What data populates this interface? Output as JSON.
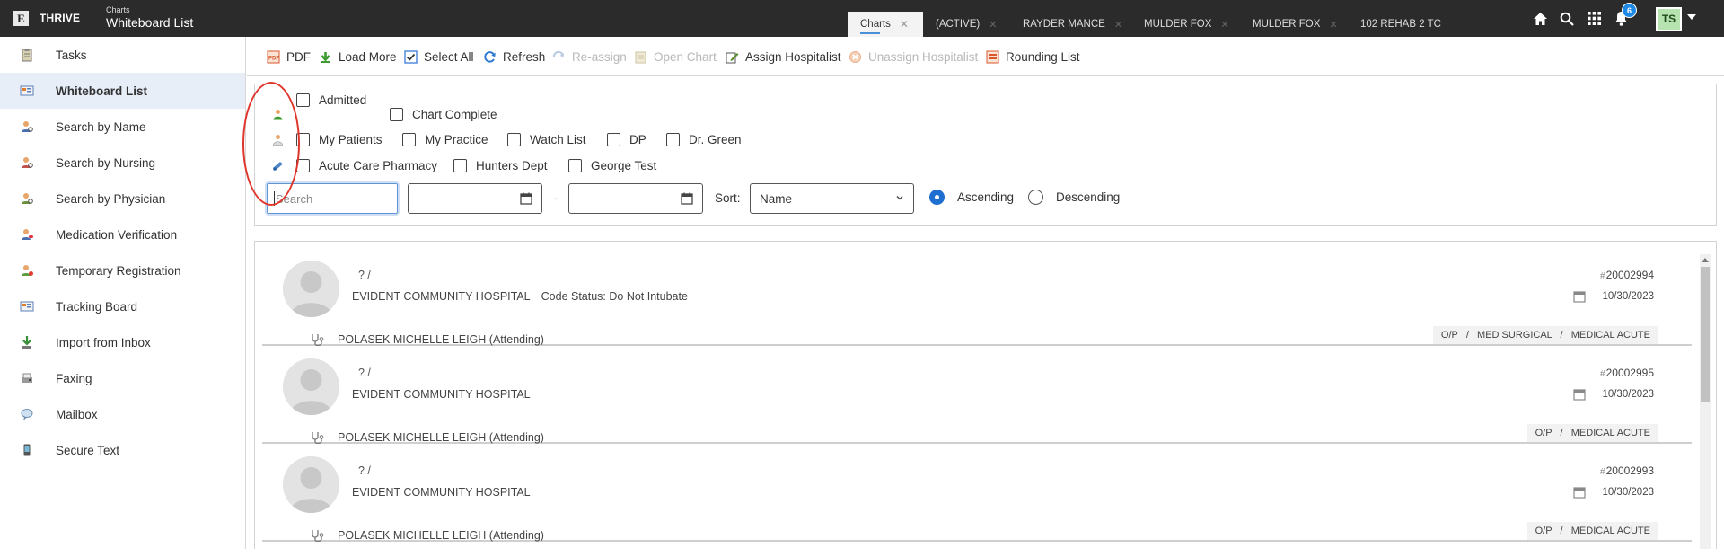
{
  "app": {
    "logo_letter": "E",
    "brand": "THRIVE",
    "section": "Charts",
    "page_title": "Whiteboard List"
  },
  "tabs": [
    {
      "label": "Charts",
      "closable": true,
      "active": true
    },
    {
      "label": "(ACTIVE)"
    },
    {
      "label": "RAYDER MANCE"
    },
    {
      "label": "MULDER FOX"
    },
    {
      "label": "MULDER FOX"
    },
    {
      "label": "102 REHAB 2 TC"
    }
  ],
  "top_icons": {
    "home": "home-icon",
    "search": "search-icon",
    "apps": "grid-icon",
    "notifications": "bell-icon",
    "notification_count": "6",
    "user_initials": "TS"
  },
  "sidebar": {
    "items": [
      {
        "label": "Tasks",
        "icon": "clipboard-icon"
      },
      {
        "label": "Whiteboard List",
        "icon": "whiteboard-icon",
        "active": true
      },
      {
        "label": "Search by Name",
        "icon": "person-search-icon"
      },
      {
        "label": "Search by Nursing",
        "icon": "nurse-search-icon"
      },
      {
        "label": "Search by Physician",
        "icon": "physician-search-icon"
      },
      {
        "label": "Medication Verification",
        "icon": "medication-icon"
      },
      {
        "label": "Temporary Registration",
        "icon": "registration-icon"
      },
      {
        "label": "Tracking Board",
        "icon": "board-icon"
      },
      {
        "label": "Import from Inbox",
        "icon": "import-icon"
      },
      {
        "label": "Faxing",
        "icon": "fax-icon"
      },
      {
        "label": "Mailbox",
        "icon": "mailbox-icon"
      },
      {
        "label": "Secure Text",
        "icon": "phone-icon"
      }
    ]
  },
  "toolbar": {
    "pdf": "PDF",
    "load_more": "Load More",
    "select_all": "Select All",
    "refresh": "Refresh",
    "reassign": "Re-assign",
    "open_chart": "Open Chart",
    "assign_hospitalist": "Assign Hospitalist",
    "unassign_hospitalist": "Unassign Hospitalist",
    "rounding_list": "Rounding List"
  },
  "filters": {
    "row1": [
      "Admitted",
      "Chart Complete"
    ],
    "row2": [
      "My Patients",
      "My Practice",
      "Watch List",
      "DP",
      "Dr. Green"
    ],
    "row3": [
      "Acute Care Pharmacy",
      "Hunters Dept",
      "George Test"
    ],
    "search_placeholder": "Search",
    "date_separator": "-",
    "sort_label": "Sort:",
    "sort_value": "Name",
    "ascending": "Ascending",
    "descending": "Descending",
    "sort_direction": "ascending"
  },
  "patients": [
    {
      "name_line": "? /",
      "facility": "EVIDENT COMMUNITY HOSPITAL",
      "code_status": "Code Status: Do Not Intubate",
      "attending": "POLASEK MICHELLE LEIGH (Attending)",
      "chart_number": "20002994",
      "date": "10/30/2023",
      "tags": "O/P   /   MED SURGICAL   /   MEDICAL ACUTE"
    },
    {
      "name_line": "? /",
      "facility": "EVIDENT COMMUNITY HOSPITAL",
      "code_status": "",
      "attending": "POLASEK MICHELLE LEIGH (Attending)",
      "chart_number": "20002995",
      "date": "10/30/2023",
      "tags": "O/P   /   MEDICAL ACUTE"
    },
    {
      "name_line": "? /",
      "facility": "EVIDENT COMMUNITY HOSPITAL",
      "code_status": "",
      "attending": "POLASEK MICHELLE LEIGH (Attending)",
      "chart_number": "20002993",
      "date": "10/30/2023",
      "tags": "O/P   /   MEDICAL ACUTE"
    }
  ],
  "colors": {
    "topbar": "#2b2b2b",
    "accent": "#1e6fd0",
    "annotation": "#e0352b",
    "active_nav": "#e7eef8"
  }
}
